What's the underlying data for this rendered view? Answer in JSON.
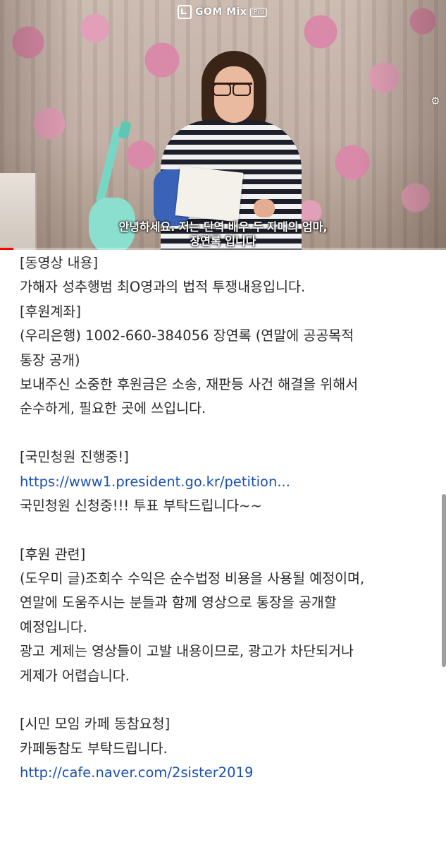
{
  "video": {
    "watermark_brand": "GOM Mix",
    "watermark_badge": "Pro",
    "subtitle_line1": "안녕하세요. 저는 단역 배우 두 자매의 엄마,",
    "subtitle_line2": "장연록 입니다",
    "progress_fraction": 0.03,
    "progress_color": "#ff0000"
  },
  "description": {
    "lines": [
      {
        "text": "[동영상 내용]",
        "kind": "text"
      },
      {
        "text": "가해자 성추행범 최O영과의 법적 투쟁내용입니다.",
        "kind": "text"
      },
      {
        "text": "[후원계좌]",
        "kind": "text"
      },
      {
        "text": "(우리은행) 1002-660-384056 장연록   (연말에 공공목적",
        "kind": "text"
      },
      {
        "text": "통장 공개)",
        "kind": "text"
      },
      {
        "text": "보내주신 소중한 후원금은 소송, 재판등 사건 해결을 위해서",
        "kind": "text"
      },
      {
        "text": "순수하게, 필요한 곳에 쓰입니다.",
        "kind": "text"
      },
      {
        "text": "",
        "kind": "blank"
      },
      {
        "text": "[국민청원 진행중!]",
        "kind": "text"
      },
      {
        "text": "https://www1.president.go.kr/petition...",
        "kind": "link"
      },
      {
        "text": "국민청원 신청중!!! 투표 부탁드립니다~~",
        "kind": "text"
      },
      {
        "text": "",
        "kind": "blank"
      },
      {
        "text": "[후원 관련]",
        "kind": "text"
      },
      {
        "text": "(도우미 글)조회수 수익은 순수법정 비용을 사용될 예정이며,",
        "kind": "text"
      },
      {
        "text": "연말에 도움주시는 분들과 함께 영상으로 통장을 공개할",
        "kind": "text"
      },
      {
        "text": "예정입니다.",
        "kind": "text"
      },
      {
        "text": "광고 게제는 영상들이 고발 내용이므로, 광고가 차단되거나",
        "kind": "text"
      },
      {
        "text": "게제가 어렵습니다.",
        "kind": "text"
      },
      {
        "text": "",
        "kind": "blank"
      },
      {
        "text": "[시민 모임 카페 동참요청]",
        "kind": "text"
      },
      {
        "text": "카페동참도 부탁드립니다.",
        "kind": "text"
      },
      {
        "text": "http://cafe.naver.com/2sister2019",
        "kind": "link"
      }
    ],
    "link_color": "#1a4fb4"
  },
  "icons": {
    "watermark": "gom-logo-icon",
    "settings": "gear-icon"
  }
}
